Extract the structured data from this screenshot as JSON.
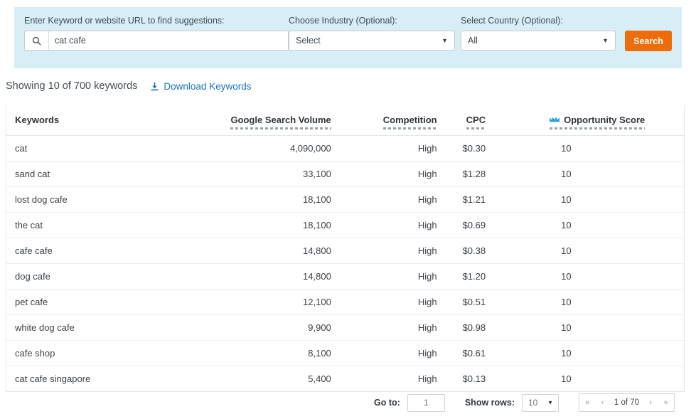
{
  "search_panel": {
    "keyword": {
      "label": "Enter Keyword or website URL to find suggestions:",
      "value": "cat cafe",
      "placeholder": "",
      "icon": "search-icon"
    },
    "industry": {
      "label": "Choose Industry (Optional):",
      "value": "Select",
      "caret": "▼"
    },
    "country": {
      "label": "Select Country (Optional):",
      "value": "All",
      "caret": "▼"
    },
    "search_button": {
      "label": "Search",
      "color": "#ef6c0b"
    },
    "background_color": "#d8eef7"
  },
  "results_bar": {
    "showing_text": "Showing 10 of 700 keywords",
    "download_label": "Download Keywords",
    "download_icon": "download-icon",
    "link_color": "#1a74b8"
  },
  "table": {
    "columns": [
      {
        "key": "keyword",
        "label": "Keywords",
        "sortable": false
      },
      {
        "key": "volume",
        "label": "Google Search Volume",
        "sortable": true
      },
      {
        "key": "competition",
        "label": "Competition",
        "sortable": true
      },
      {
        "key": "cpc",
        "label": "CPC",
        "sortable": true
      },
      {
        "key": "opportunity",
        "label": "Opportunity Score",
        "sortable": true,
        "icon": "sort-crown-icon"
      }
    ],
    "rows": [
      {
        "keyword": "cat",
        "volume": "4,090,000",
        "competition": "High",
        "cpc": "$0.30",
        "opportunity": "10"
      },
      {
        "keyword": "sand cat",
        "volume": "33,100",
        "competition": "High",
        "cpc": "$1.28",
        "opportunity": "10"
      },
      {
        "keyword": "lost dog cafe",
        "volume": "18,100",
        "competition": "High",
        "cpc": "$1.21",
        "opportunity": "10"
      },
      {
        "keyword": "the cat",
        "volume": "18,100",
        "competition": "High",
        "cpc": "$0.69",
        "opportunity": "10"
      },
      {
        "keyword": "cafe cafe",
        "volume": "14,800",
        "competition": "High",
        "cpc": "$0.38",
        "opportunity": "10"
      },
      {
        "keyword": "dog cafe",
        "volume": "14,800",
        "competition": "High",
        "cpc": "$1.20",
        "opportunity": "10"
      },
      {
        "keyword": "pet cafe",
        "volume": "12,100",
        "competition": "High",
        "cpc": "$0.51",
        "opportunity": "10"
      },
      {
        "keyword": "white dog cafe",
        "volume": "9,900",
        "competition": "High",
        "cpc": "$0.98",
        "opportunity": "10"
      },
      {
        "keyword": "cafe shop",
        "volume": "8,100",
        "competition": "High",
        "cpc": "$0.61",
        "opportunity": "10"
      },
      {
        "keyword": "cat cafe singapore",
        "volume": "5,400",
        "competition": "High",
        "cpc": "$0.13",
        "opportunity": "10"
      }
    ]
  },
  "footer": {
    "goto_label": "Go to:",
    "goto_value": "1",
    "rows_label": "Show rows:",
    "rows_value": "10",
    "rows_caret": "▼",
    "pager": {
      "first": "«",
      "prev": "‹",
      "label": "1 of 70",
      "next": "›",
      "last": "»"
    }
  }
}
